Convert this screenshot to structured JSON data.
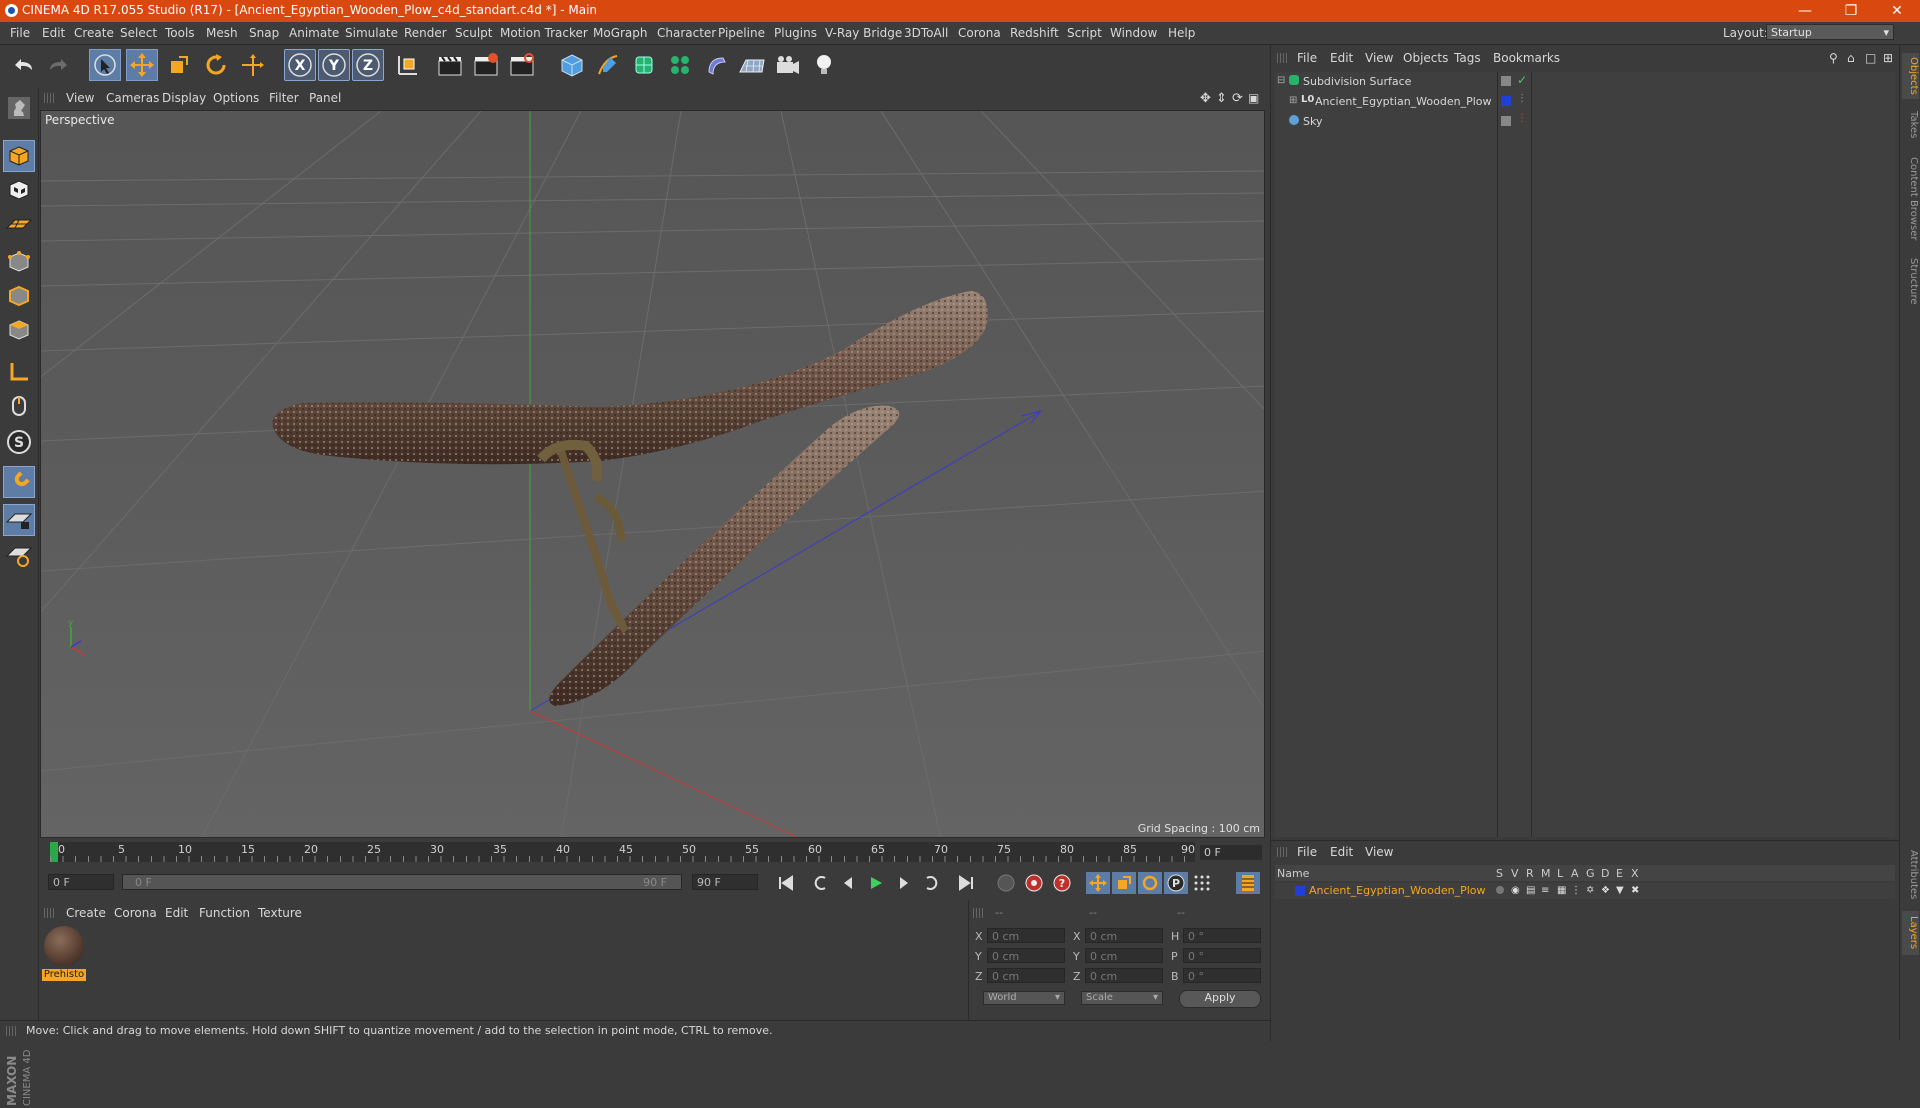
{
  "window": {
    "title": "CINEMA 4D R17.055 Studio (R17) - [Ancient_Egyptian_Wooden_Plow_c4d_standart.c4d *] - Main"
  },
  "menu": [
    "File",
    "Edit",
    "Create",
    "Select",
    "Tools",
    "Mesh",
    "Snap",
    "Animate",
    "Simulate",
    "Render",
    "Sculpt",
    "Motion Tracker",
    "MoGraph",
    "Character",
    "Pipeline",
    "Plugins",
    "V-Ray Bridge",
    "3DToAll",
    "Corona",
    "Redshift",
    "Script",
    "Window",
    "Help"
  ],
  "layout": {
    "label": "Layout:",
    "value": "Startup"
  },
  "viewport": {
    "menu": [
      "View",
      "Cameras",
      "Display",
      "Options",
      "Filter",
      "Panel"
    ],
    "camera_label": "Perspective",
    "grid_spacing": "Grid Spacing : 100 cm"
  },
  "timeline": {
    "ticks": [
      "0",
      "5",
      "10",
      "15",
      "20",
      "25",
      "30",
      "35",
      "40",
      "45",
      "50",
      "55",
      "60",
      "65",
      "70",
      "75",
      "80",
      "85",
      "90"
    ],
    "current_frame": "0 F",
    "start_field": "0 F",
    "range_start": "0 F",
    "range_end": "90 F",
    "end_field": "90 F"
  },
  "material_panel": {
    "menu": [
      "Create",
      "Corona",
      "Edit",
      "Function",
      "Texture"
    ],
    "materials": [
      {
        "name": "Prehisto"
      }
    ]
  },
  "coords": {
    "headers": [
      "--",
      "--",
      "--"
    ],
    "rows": [
      {
        "a": "X",
        "av": "0 cm",
        "b": "X",
        "bv": "0 cm",
        "c": "H",
        "cv": "0 °"
      },
      {
        "a": "Y",
        "av": "0 cm",
        "b": "Y",
        "bv": "0 cm",
        "c": "P",
        "cv": "0 °"
      },
      {
        "a": "Z",
        "av": "0 cm",
        "b": "Z",
        "bv": "0 cm",
        "c": "B",
        "cv": "0 °"
      }
    ],
    "mode": "World",
    "size_mode": "Scale",
    "apply": "Apply"
  },
  "status": "Move: Click and drag to move elements. Hold down SHIFT to quantize movement / add to the selection in point mode, CTRL to remove.",
  "objects_panel": {
    "menu": [
      "File",
      "Edit",
      "View",
      "Objects",
      "Tags",
      "Bookmarks"
    ],
    "items": [
      {
        "name": "Subdivision Surface",
        "indent": 0
      },
      {
        "name": "Ancient_Egyptian_Wooden_Plow",
        "indent": 1,
        "layer_color": "#1f3fd6"
      },
      {
        "name": "Sky",
        "indent": 0
      }
    ]
  },
  "layers_panel": {
    "menu": [
      "File",
      "Edit",
      "View"
    ],
    "columns": [
      "Name",
      "S",
      "V",
      "R",
      "M",
      "L",
      "A",
      "G",
      "D",
      "E",
      "X"
    ],
    "rows": [
      {
        "name": "Ancient_Egyptian_Wooden_Plow",
        "color": "#1f3fd6"
      }
    ]
  },
  "right_tabs": [
    "Objects",
    "Takes",
    "Content Browser",
    "Structure",
    "Attributes",
    "Layers"
  ],
  "maxon_logo": "MAXON CINEMA 4D",
  "colors": {
    "title_bar": "#d9480f",
    "accent": "#f5a623",
    "select_blue": "#5d7ca6"
  }
}
